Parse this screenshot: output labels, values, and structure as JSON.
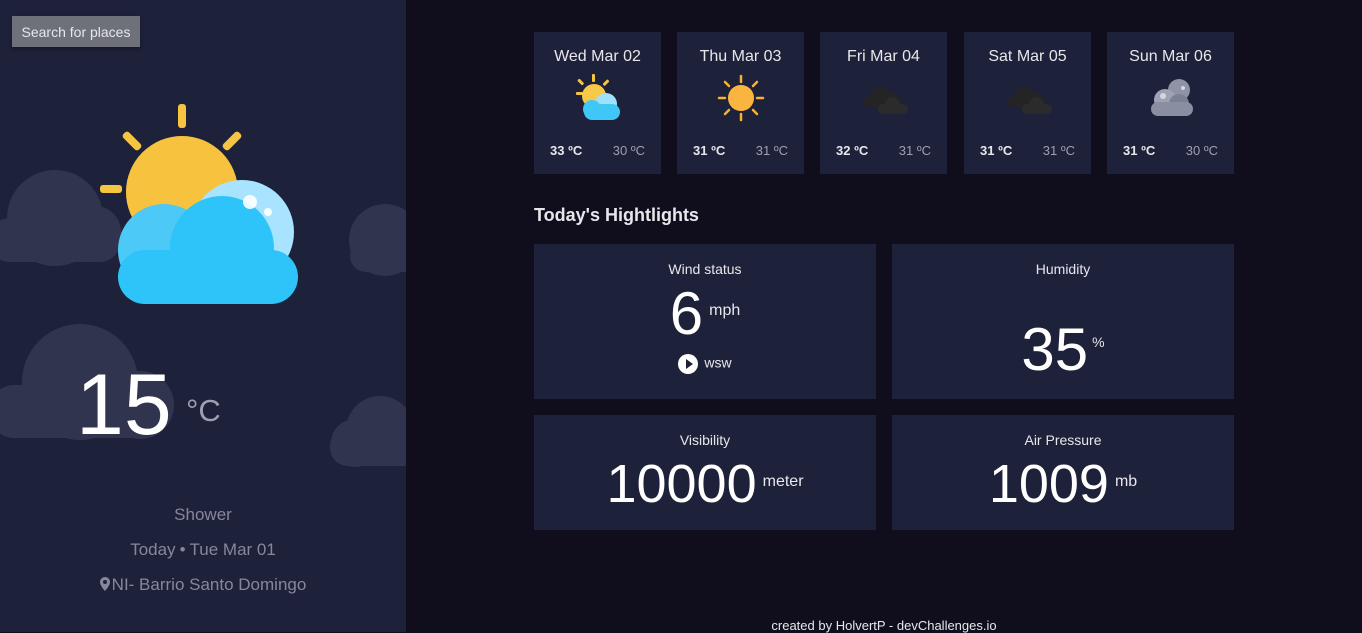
{
  "sidebar": {
    "search_label": "Search for places",
    "current_icon": "sun-behind-cloud-icon",
    "temperature": "15",
    "temperature_unit": "°C",
    "condition": "Shower",
    "date_prefix": "Today",
    "date_separator": "•",
    "date": "Tue Mar 01",
    "location": "NI- Barrio Santo Domingo"
  },
  "forecast": [
    {
      "date": "Wed Mar 02",
      "icon": "sun-behind-cloud-icon",
      "max": "33 ºC",
      "min": "30 ºC"
    },
    {
      "date": "Thu Mar 03",
      "icon": "sun-icon",
      "max": "31 ºC",
      "min": "31 ºC"
    },
    {
      "date": "Fri Mar 04",
      "icon": "dark-cloud-icon",
      "max": "32 ºC",
      "min": "31 ºC"
    },
    {
      "date": "Sat Mar 05",
      "icon": "dark-cloud-icon",
      "max": "31 ºC",
      "min": "31 ºC"
    },
    {
      "date": "Sun Mar 06",
      "icon": "storm-cloud-icon",
      "max": "31 ºC",
      "min": "30 ºC"
    }
  ],
  "highlights": {
    "title": "Today's Hightlights",
    "wind": {
      "label": "Wind status",
      "value": "6",
      "unit": "mph",
      "direction": "wsw"
    },
    "humidity": {
      "label": "Humidity",
      "value": "35",
      "unit": "%"
    },
    "visibility": {
      "label": "Visibility",
      "value": "10000",
      "unit": "meter"
    },
    "pressure": {
      "label": "Air Pressure",
      "value": "1009",
      "unit": "mb"
    }
  },
  "footer": "created by HolvertP - devChallenges.io",
  "colors": {
    "background": "#100e1d",
    "panel": "#1e213a",
    "search_button": "#6e707a",
    "text_primary": "#e7e7eb",
    "text_muted": "#88869d"
  }
}
